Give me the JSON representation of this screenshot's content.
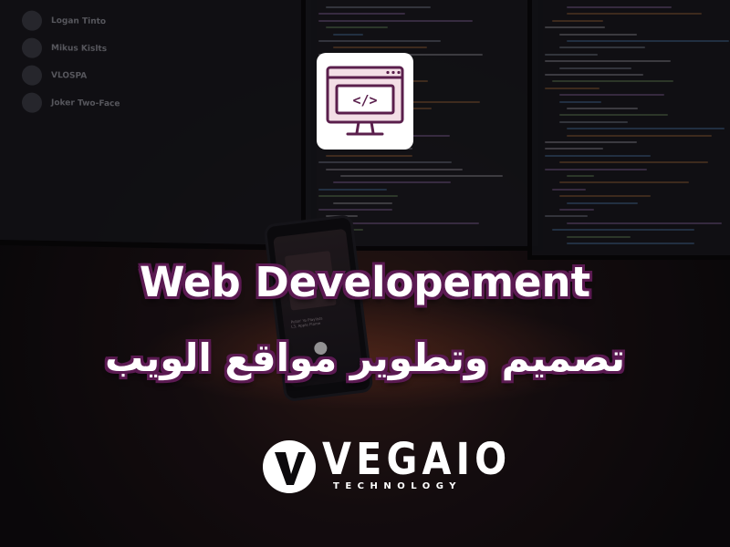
{
  "background": {
    "chat_names": [
      "Logan Tinto",
      "Mikus Kislts",
      "VLOSPA",
      "Joker Two-Face"
    ],
    "phone_song": [
      "Pullin' Yo Playlists",
      "L3, Apple Flame"
    ]
  },
  "icon": {
    "name": "web-code-monitor-icon",
    "glyph": "</>"
  },
  "title_en": "Web Developement",
  "title_ar": "تصميم وتطوير مواقع الويب",
  "brand": {
    "name": "VEGAIO",
    "tagline": "TECHNOLOGY"
  },
  "colors": {
    "title_outline": "#5b1a52",
    "icon_outline": "#5a1f4c",
    "icon_fill": "#f3dfe6"
  }
}
